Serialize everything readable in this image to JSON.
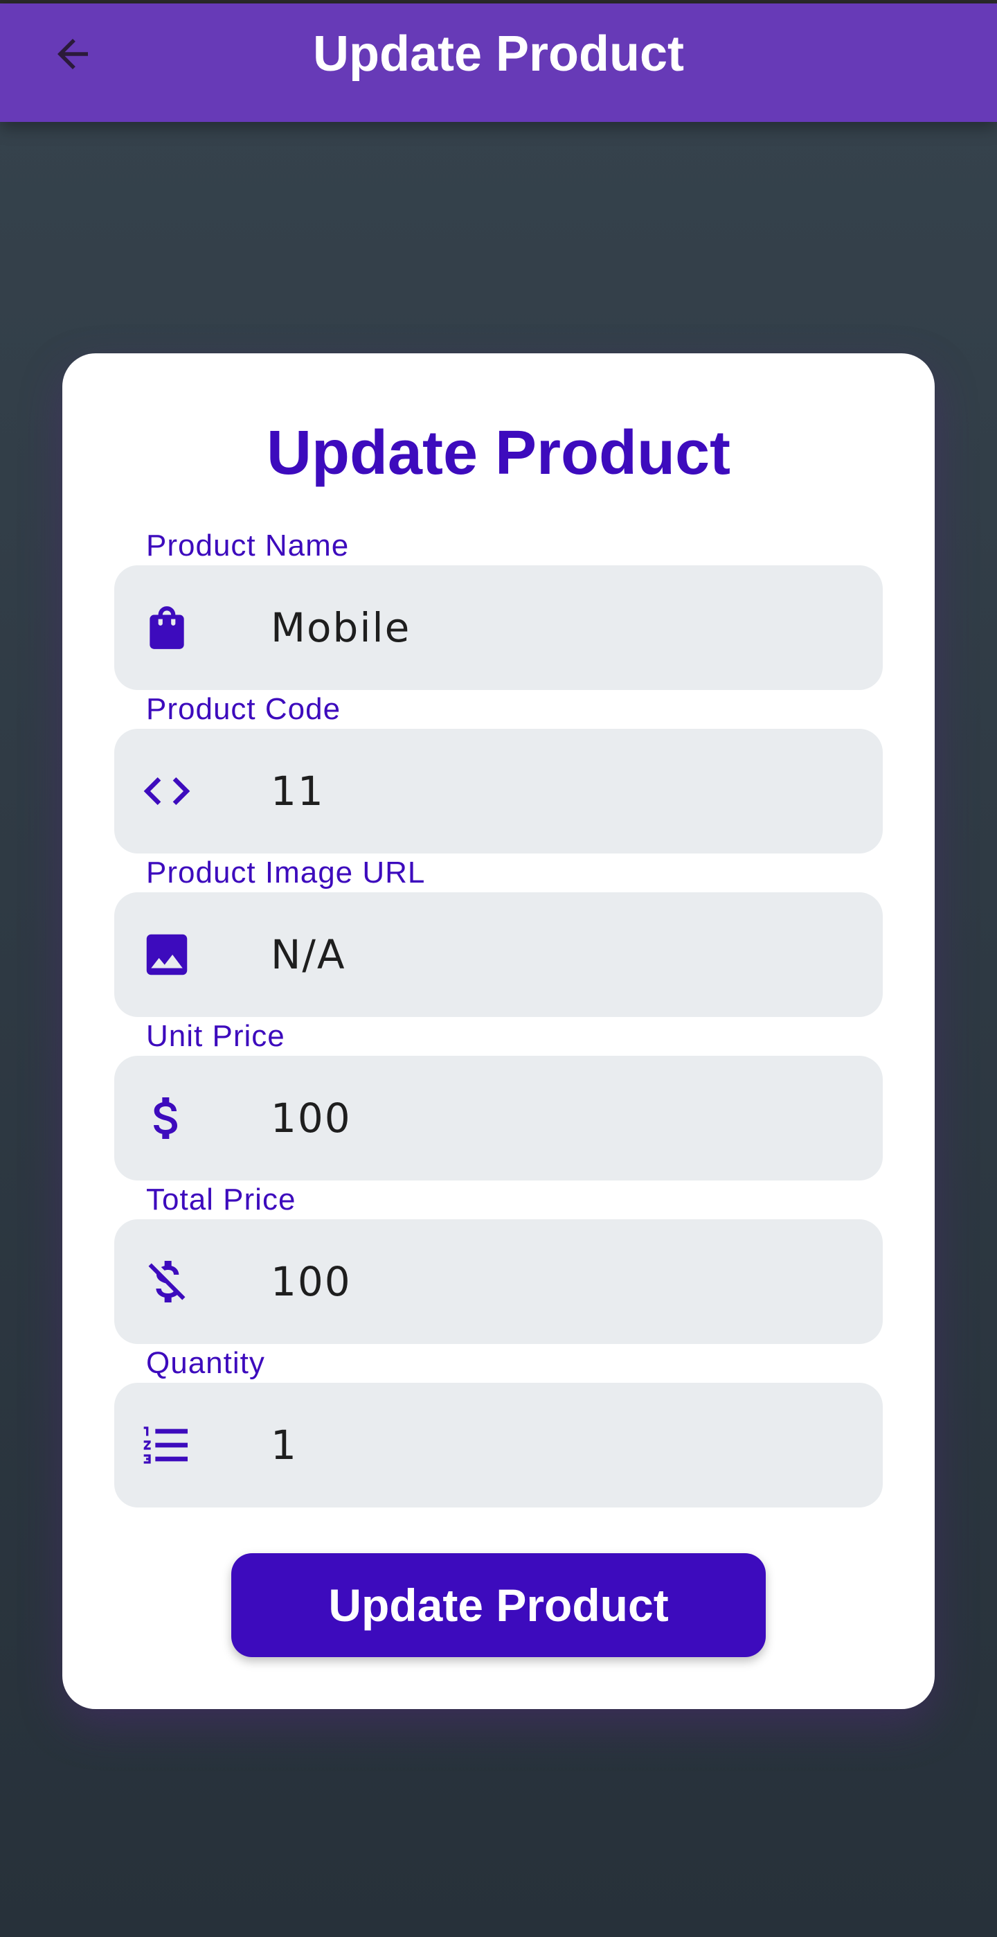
{
  "appbar": {
    "title": "Update Product",
    "back_icon": "arrow-back-icon",
    "color": "#673ab7"
  },
  "form": {
    "title": "Update Product",
    "accent": "#3d0bbd",
    "fields": [
      {
        "label": "Product Name",
        "value": "Mobile",
        "icon": "shopping-bag-icon"
      },
      {
        "label": "Product Code",
        "value": "11",
        "icon": "code-icon"
      },
      {
        "label": "Product Image URL",
        "value": "N/A",
        "icon": "image-icon"
      },
      {
        "label": "Unit Price",
        "value": "100",
        "icon": "dollar-icon"
      },
      {
        "label": "Total Price",
        "value": "100",
        "icon": "money-off-icon"
      },
      {
        "label": "Quantity",
        "value": "1",
        "icon": "numbered-list-icon"
      }
    ],
    "submit_label": "Update Product"
  }
}
